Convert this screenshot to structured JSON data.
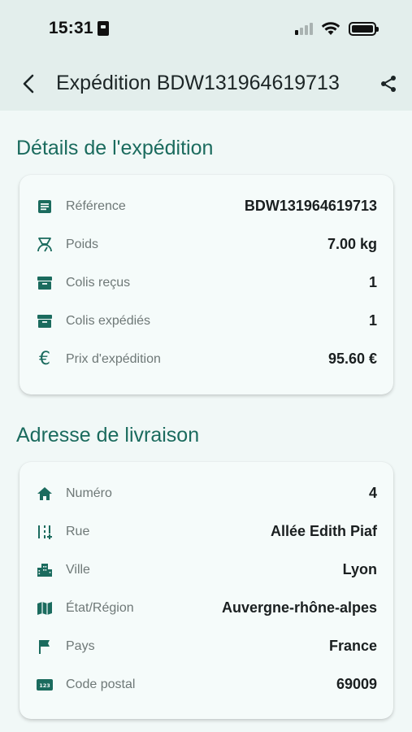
{
  "status": {
    "time": "15:31"
  },
  "appbar": {
    "title": "Expédition BDW131964619713"
  },
  "shipment": {
    "title": "Détails de l'expédition",
    "rows": [
      {
        "icon": "document-icon",
        "label": "Référence",
        "value": "BDW131964619713"
      },
      {
        "icon": "scale-icon",
        "label": "Poids",
        "value": "7.00 kg"
      },
      {
        "icon": "archive-box-icon",
        "label": "Colis reçus",
        "value": "1"
      },
      {
        "icon": "archive-box-icon",
        "label": "Colis expédiés",
        "value": "1"
      },
      {
        "icon": "euro-icon",
        "label": "Prix d'expédition",
        "value": "95.60 €"
      }
    ]
  },
  "address": {
    "title": "Adresse de livraison",
    "rows": [
      {
        "icon": "home-icon",
        "label": "Numéro",
        "value": "4"
      },
      {
        "icon": "road-icon",
        "label": "Rue",
        "value": "Allée Edith Piaf"
      },
      {
        "icon": "city-icon",
        "label": "Ville",
        "value": "Lyon"
      },
      {
        "icon": "map-icon",
        "label": "État/Région",
        "value": "Auvergne-rhône-alpes"
      },
      {
        "icon": "flag-icon",
        "label": "Pays",
        "value": "France"
      },
      {
        "icon": "numbers-icon",
        "label": "Code postal",
        "value": "69009"
      }
    ]
  },
  "colors": {
    "accent": "#1b6b5e",
    "header_bg": "#e3eeec",
    "page_bg": "#f1f8f7"
  }
}
